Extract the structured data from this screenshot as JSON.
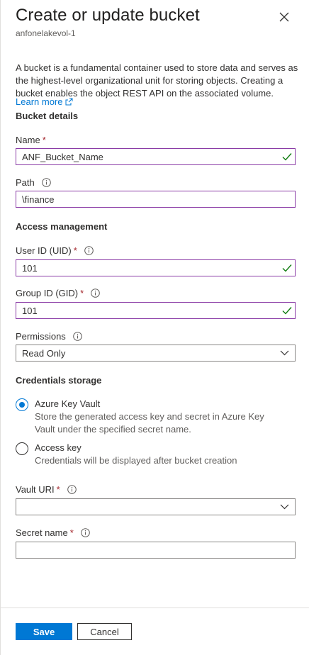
{
  "header": {
    "title": "Create or update bucket",
    "subtitle": "anfonelakevol-1"
  },
  "description": "A bucket is a fundamental container used to store data and serves as the highest-level organizational unit for storing objects. Creating a bucket enables the object REST API on the associated volume.",
  "learn_more": "Learn more",
  "bucket_details": {
    "heading": "Bucket details",
    "name_label": "Name",
    "name_value": "ANF_Bucket_Name",
    "path_label": "Path",
    "path_value": "\\finance"
  },
  "access": {
    "heading": "Access management",
    "uid_label": "User ID (UID)",
    "uid_value": "101",
    "gid_label": "Group ID (GID)",
    "gid_value": "101",
    "permissions_label": "Permissions",
    "permissions_value": "Read Only"
  },
  "credentials": {
    "heading": "Credentials storage",
    "options": [
      {
        "label": "Azure Key Vault",
        "description": "Store the generated access key and secret in Azure Key Vault under the specified secret name.",
        "selected": true
      },
      {
        "label": "Access key",
        "description": "Credentials will be displayed after bucket creation",
        "selected": false
      }
    ],
    "vault_uri_label": "Vault URI",
    "vault_uri_value": "",
    "secret_name_label": "Secret name",
    "secret_name_value": ""
  },
  "footer": {
    "save": "Save",
    "cancel": "Cancel"
  },
  "required_marker": "*",
  "colors": {
    "accent": "#0078d4",
    "valid_border": "#8a3ba6",
    "valid_check": "#107c10",
    "required": "#a4262c"
  },
  "icons": [
    "close-icon",
    "external-link-icon",
    "info-icon",
    "checkmark-icon",
    "chevron-down-icon"
  ]
}
